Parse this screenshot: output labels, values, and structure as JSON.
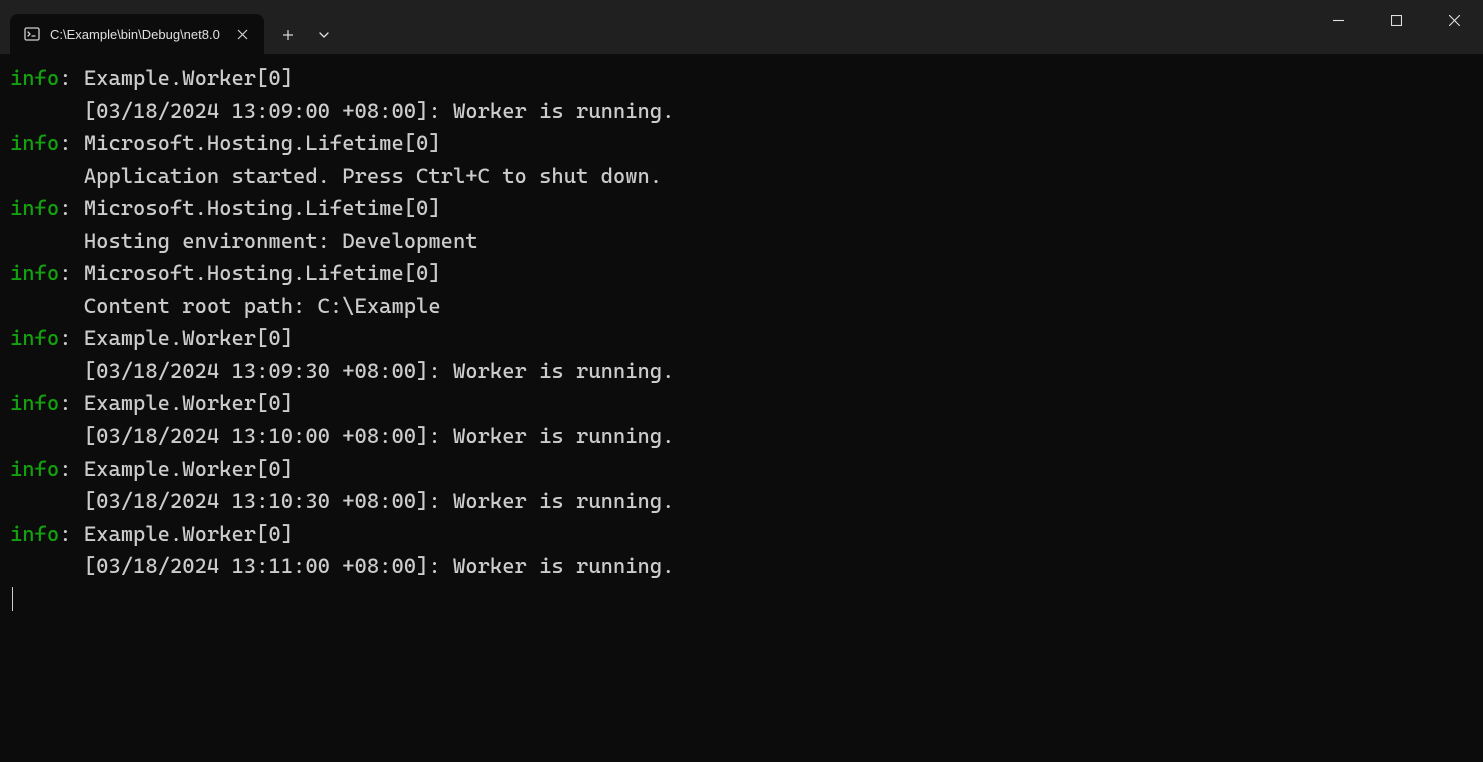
{
  "titlebar": {
    "tab_title": "C:\\Example\\bin\\Debug\\net8.0",
    "new_tab_label": "+",
    "dropdown_label": "⌄"
  },
  "colors": {
    "info_level": "#13a10e",
    "text": "#cccccc",
    "background": "#0c0c0c",
    "titlebar": "#202020"
  },
  "log_entries": [
    {
      "level": "info",
      "source": "Example.Worker[0]",
      "message": "[03/18/2024 13:09:00 +08:00]: Worker is running."
    },
    {
      "level": "info",
      "source": "Microsoft.Hosting.Lifetime[0]",
      "message": "Application started. Press Ctrl+C to shut down."
    },
    {
      "level": "info",
      "source": "Microsoft.Hosting.Lifetime[0]",
      "message": "Hosting environment: Development"
    },
    {
      "level": "info",
      "source": "Microsoft.Hosting.Lifetime[0]",
      "message": "Content root path: C:\\Example"
    },
    {
      "level": "info",
      "source": "Example.Worker[0]",
      "message": "[03/18/2024 13:09:30 +08:00]: Worker is running."
    },
    {
      "level": "info",
      "source": "Example.Worker[0]",
      "message": "[03/18/2024 13:10:00 +08:00]: Worker is running."
    },
    {
      "level": "info",
      "source": "Example.Worker[0]",
      "message": "[03/18/2024 13:10:30 +08:00]: Worker is running."
    },
    {
      "level": "info",
      "source": "Example.Worker[0]",
      "message": "[03/18/2024 13:11:00 +08:00]: Worker is running."
    }
  ]
}
